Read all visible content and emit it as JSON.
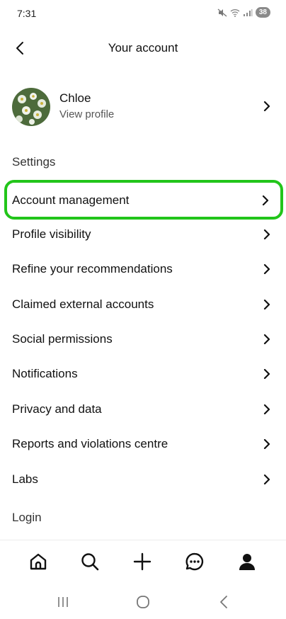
{
  "status_bar": {
    "time": "7:31",
    "battery": "38"
  },
  "header": {
    "title": "Your account"
  },
  "profile": {
    "name": "Chloe",
    "subtitle": "View profile"
  },
  "settings_section": {
    "label": "Settings",
    "items": [
      {
        "label": "Account management",
        "highlighted": true
      },
      {
        "label": "Profile visibility"
      },
      {
        "label": "Refine your recommendations"
      },
      {
        "label": "Claimed external accounts"
      },
      {
        "label": "Social permissions"
      },
      {
        "label": "Notifications"
      },
      {
        "label": "Privacy and data"
      },
      {
        "label": "Reports and violations centre"
      },
      {
        "label": "Labs"
      }
    ]
  },
  "login_section": {
    "label": "Login"
  },
  "bottom_nav": {
    "items": [
      "home-icon",
      "search-icon",
      "plus-icon",
      "messages-icon",
      "profile-icon"
    ]
  },
  "system_nav": {
    "items": [
      "recent-apps-icon",
      "home-circle-icon",
      "back-icon"
    ]
  },
  "colors": {
    "highlight": "#22c51a",
    "text": "#111111",
    "secondary_text": "#555555"
  }
}
